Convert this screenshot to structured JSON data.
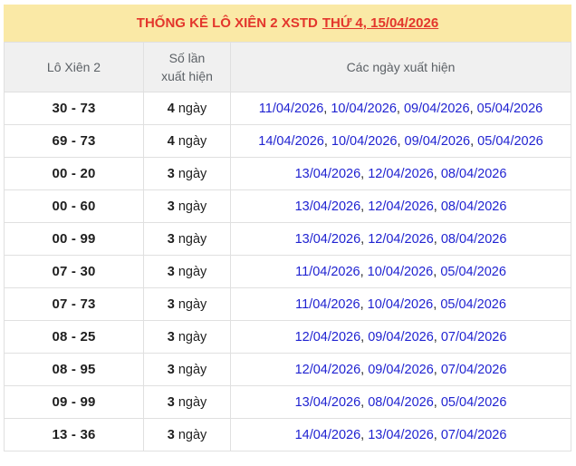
{
  "title": {
    "prefix": "THỐNG KÊ LÔ XIÊN 2 XSTD",
    "link": "THỨ 4, 15/04/2026"
  },
  "table": {
    "columns": [
      "Lô Xiên 2",
      "Số lần xuất hiện",
      "Các ngày xuất hiện"
    ],
    "count_unit": "ngày",
    "date_separator": ", ",
    "rows": [
      {
        "pair": "30 - 73",
        "count": "4",
        "dates": [
          "11/04/2026",
          "10/04/2026",
          "09/04/2026",
          "05/04/2026"
        ]
      },
      {
        "pair": "69 - 73",
        "count": "4",
        "dates": [
          "14/04/2026",
          "10/04/2026",
          "09/04/2026",
          "05/04/2026"
        ]
      },
      {
        "pair": "00 - 20",
        "count": "3",
        "dates": [
          "13/04/2026",
          "12/04/2026",
          "08/04/2026"
        ]
      },
      {
        "pair": "00 - 60",
        "count": "3",
        "dates": [
          "13/04/2026",
          "12/04/2026",
          "08/04/2026"
        ]
      },
      {
        "pair": "00 - 99",
        "count": "3",
        "dates": [
          "13/04/2026",
          "12/04/2026",
          "08/04/2026"
        ]
      },
      {
        "pair": "07 - 30",
        "count": "3",
        "dates": [
          "11/04/2026",
          "10/04/2026",
          "05/04/2026"
        ]
      },
      {
        "pair": "07 - 73",
        "count": "3",
        "dates": [
          "11/04/2026",
          "10/04/2026",
          "05/04/2026"
        ]
      },
      {
        "pair": "08 - 25",
        "count": "3",
        "dates": [
          "12/04/2026",
          "09/04/2026",
          "07/04/2026"
        ]
      },
      {
        "pair": "08 - 95",
        "count": "3",
        "dates": [
          "12/04/2026",
          "09/04/2026",
          "07/04/2026"
        ]
      },
      {
        "pair": "09 - 99",
        "count": "3",
        "dates": [
          "13/04/2026",
          "08/04/2026",
          "05/04/2026"
        ]
      },
      {
        "pair": "13 - 36",
        "count": "3",
        "dates": [
          "14/04/2026",
          "13/04/2026",
          "07/04/2026"
        ]
      }
    ]
  },
  "colors": {
    "banner_bg": "#FAE9A6",
    "title_red": "#E3362C",
    "link_blue": "#2023D1",
    "header_bg": "#F0F0F0",
    "header_text": "#5C6166",
    "border": "#E0E0E0"
  }
}
